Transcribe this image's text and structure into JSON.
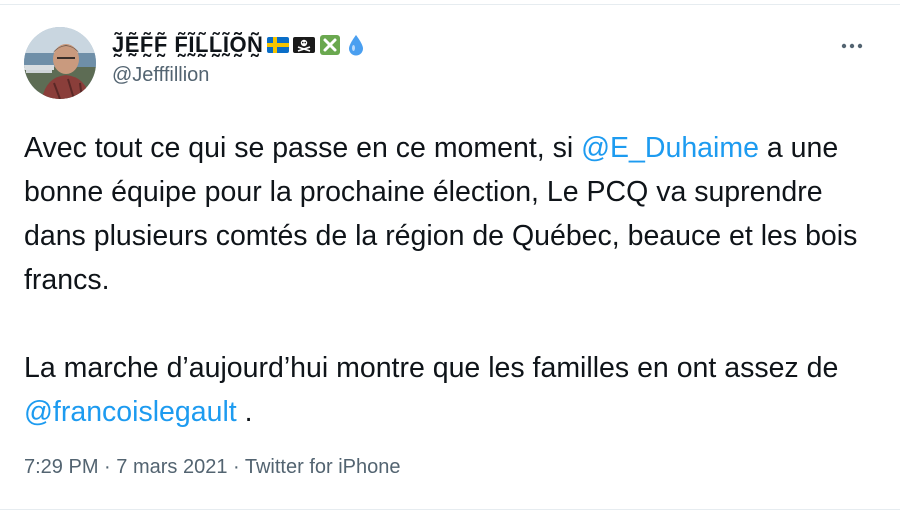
{
  "tweet": {
    "author": {
      "display_name": "J̰̃Ḛ̃F̰̃F̰̃ F̰̃Ḭ̃L̰̃L̰̃Ḭ̃Õ̰Ñ̰",
      "handle": "@Jefffillion",
      "badges": [
        "sweden-flag-icon",
        "pirate-flag-icon",
        "cross-mark-icon",
        "droplet-icon"
      ],
      "colors": {
        "sweden_blue": "#0a6ec7",
        "sweden_yellow": "#f5c400",
        "cross_green": "#6aa84f",
        "droplet_blue": "#4a9ff0"
      }
    },
    "menu_icon": "more-horizontal-icon",
    "body": {
      "p1_before": "Avec tout ce qui se passe en ce moment, si ",
      "mention1": "@E_Duhaime",
      "p1_after": " a une bonne équipe pour la prochaine élection, Le PCQ va suprendre dans plusieurs comtés de la région de Québec, beauce et les bois francs.",
      "p2_before": "La marche d’aujourd’hui montre que les familles en ont assez de ",
      "mention2": "@francoislegault",
      "p2_after": " ."
    },
    "time": "7:29 PM",
    "separator1": " · ",
    "date": "7 mars 2021",
    "separator2": " · ",
    "source": "Twitter for iPhone",
    "accent_color": "#1d9bf0",
    "secondary_text_color": "#536471"
  }
}
